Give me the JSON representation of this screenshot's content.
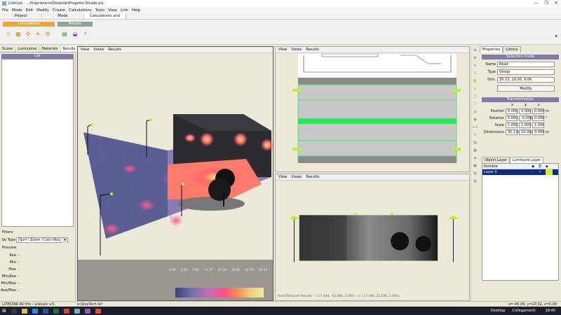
{
  "window": {
    "title": "LiteCalc - ...Proprietario\\Desktop\\Progetto Strade.prj",
    "min": "—",
    "max": "❐",
    "close": "✕"
  },
  "menu": [
    "File",
    "Mode",
    "Edit",
    "Modify",
    "Create",
    "Calculations",
    "Tools",
    "View",
    "Link",
    "Help"
  ],
  "ribbon_tabs": [
    "Project",
    "Mode",
    "Calculations and Results"
  ],
  "ribbon_groups": {
    "calculations": "Calculations",
    "results": "Results"
  },
  "left": {
    "tabs": [
      "Scene",
      "Luminaires",
      "Materials",
      "Results"
    ],
    "list_header": "List",
    "filters_label": "Filters",
    "by_type_label": "by Type",
    "by_type_value": "[Surf / Zoom / Calc-Obs]",
    "preview_label": "Preview",
    "stats": [
      {
        "k": "Ave",
        "v": "-"
      },
      {
        "k": "Min",
        "v": "-"
      },
      {
        "k": "Max",
        "v": "-"
      },
      {
        "k": "Min/Ave",
        "v": "-"
      },
      {
        "k": "Min/Max",
        "v": "-"
      },
      {
        "k": "Ave/Max",
        "v": "-"
      }
    ]
  },
  "view_menu": [
    "View",
    "Views",
    "Results"
  ],
  "scale": {
    "ticks": [
      "0.00",
      "3.78",
      "7.56",
      "11.37",
      "15.16",
      "18.95",
      "22.74",
      "26.53"
    ],
    "colors": [
      "#3b3f7a",
      "#7a6fb0",
      "#c86fb0",
      "#ff4f8a",
      "#ff7a5a",
      "#ffb060",
      "#f0e070",
      "#e8ef9a"
    ]
  },
  "front_view_status": "Front/Textured Results -- ( 17.440, -52.686, 5.000 ) -> ( 17.440, 22.566, 5.000 )",
  "properties": {
    "tabs": [
      "Properties",
      "Library"
    ],
    "selection_header": "Selection mode",
    "name_label": "Name",
    "name_value": "Road",
    "type_label": "Type",
    "type_value": "Group",
    "dim_label": "Dim.",
    "dim_value": "35.13, 19.00, 9.06",
    "modify_button": "Modify",
    "transform_header": "Transformation",
    "axes": [
      "x",
      "y",
      "z"
    ],
    "rows": [
      {
        "label": "Position",
        "x": "0.000",
        "y": "0.000",
        "z": "0.000",
        "unit": "m"
      },
      {
        "label": "Rotation",
        "x": "0.000",
        "y": "-0.000",
        "z": "0.000",
        "unit": "°"
      },
      {
        "label": "Scale",
        "x": "1.000",
        "y": "1.000",
        "z": "1.000",
        "unit": ""
      },
      {
        "label": "Dimensions",
        "x": "35.130",
        "y": "19.000",
        "z": "9.065",
        "unit": "m"
      }
    ],
    "layer_tabs": [
      "Object Layer",
      "Luminaire Layer"
    ],
    "layer_cols": [
      "Nombre"
    ],
    "layer_row": {
      "name": "Layer 0",
      "dash": "-",
      "check": "✓"
    },
    "layer_color": "#d8ef1e"
  },
  "status": {
    "left": "LITESTAR 4D Pro - Litecalc v.5",
    "company": "(c)OxyTech Srl",
    "coords": "x=-40.09, y=20.52, z=0.00"
  },
  "taskbar": {
    "desktop": "Desktop",
    "links": "Collegamenti",
    "time": "18:40"
  },
  "colors": {
    "calc_group": "#f5a623",
    "results_group": "#8fa58f",
    "header_purple": "#7f7aa8",
    "green": "#2ee65a"
  }
}
